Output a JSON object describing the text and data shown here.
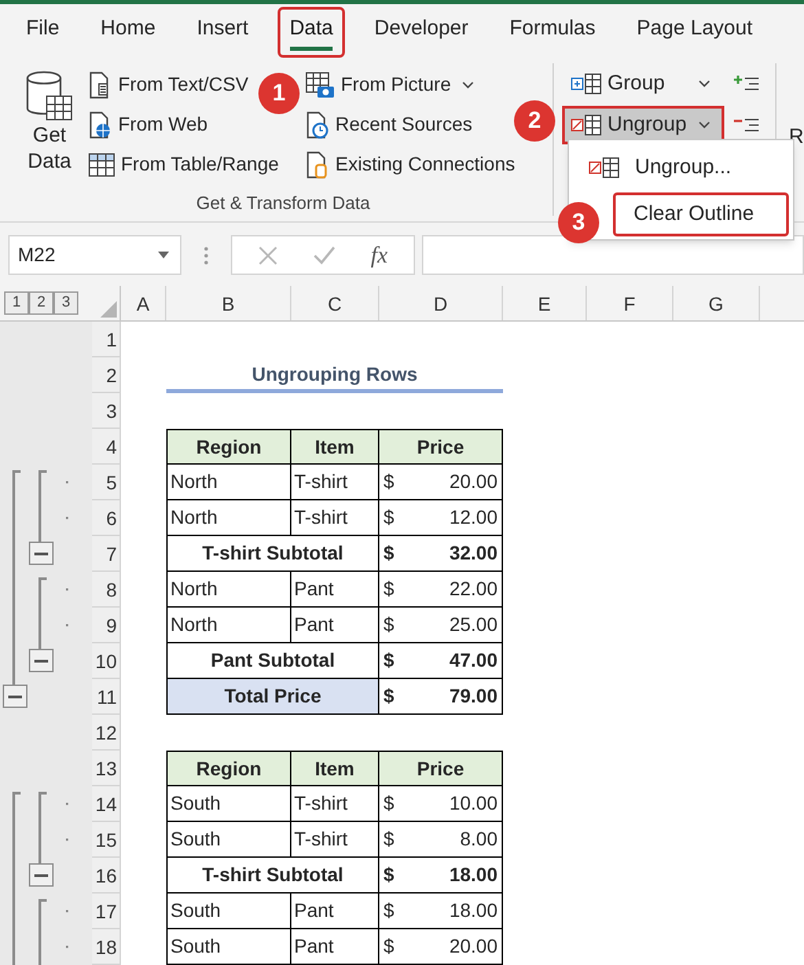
{
  "ribbon_tabs": [
    {
      "label": "File",
      "selected": false,
      "highlighted": false
    },
    {
      "label": "Home",
      "selected": false,
      "highlighted": false
    },
    {
      "label": "Insert",
      "selected": false,
      "highlighted": false
    },
    {
      "label": "Data",
      "selected": true,
      "highlighted": true
    },
    {
      "label": "Developer",
      "selected": false,
      "highlighted": false
    },
    {
      "label": "Formulas",
      "selected": false,
      "highlighted": false
    },
    {
      "label": "Page Layout",
      "selected": false,
      "highlighted": false
    }
  ],
  "get_data": {
    "label": "Get Data"
  },
  "commands": [
    {
      "kind": "text",
      "label": "From Text/CSV",
      "dropdown": false
    },
    {
      "kind": "web",
      "label": "From Web",
      "dropdown": false
    },
    {
      "kind": "table",
      "label": "From Table/Range",
      "dropdown": false
    },
    {
      "kind": "picture",
      "label": "From Picture",
      "dropdown": true
    },
    {
      "kind": "recent",
      "label": "Recent Sources",
      "dropdown": false
    },
    {
      "kind": "connections",
      "label": "Existing Connections",
      "dropdown": false
    }
  ],
  "group_label": "Get & Transform Data",
  "outline_commands": [
    {
      "kind": "group",
      "label": "Group",
      "expanded": false,
      "highlighted": false
    },
    {
      "kind": "ungroup",
      "label": "Ungroup",
      "expanded": true,
      "highlighted": true
    }
  ],
  "next_group_label": "R",
  "dropdown_menu": [
    {
      "kind": "ungroup",
      "label": "Ungroup...",
      "highlighted": false
    },
    {
      "kind": "clear",
      "label": "Clear Outline",
      "highlighted": true
    }
  ],
  "step_badges": [
    "1",
    "2",
    "3"
  ],
  "formula_bar": {
    "name_box": "M22",
    "function_label": "fx"
  },
  "outline_levels": [
    "1",
    "2",
    "3"
  ],
  "columns": [
    "A",
    "B",
    "C",
    "D",
    "E",
    "F",
    "G"
  ],
  "row_numbers": [
    "1",
    "2",
    "3",
    "4",
    "5",
    "6",
    "7",
    "8",
    "9",
    "10",
    "11",
    "12",
    "13",
    "14",
    "15",
    "16",
    "17",
    "18"
  ],
  "title": "Ungrouping Rows",
  "tables": [
    {
      "header": [
        "Region",
        "Item",
        "Price"
      ],
      "rows": [
        {
          "kind": "item",
          "region": "North",
          "item": "T-shirt",
          "currency": "$",
          "amount": "20.00"
        },
        {
          "kind": "item",
          "region": "North",
          "item": "T-shirt",
          "currency": "$",
          "amount": "12.00"
        },
        {
          "kind": "subtotal",
          "label": "T-shirt Subtotal",
          "currency": "$",
          "amount": "32.00",
          "expanded": true
        },
        {
          "kind": "item",
          "region": "North",
          "item": "Pant",
          "currency": "$",
          "amount": "22.00"
        },
        {
          "kind": "item",
          "region": "North",
          "item": "Pant",
          "currency": "$",
          "amount": "25.00"
        },
        {
          "kind": "subtotal",
          "label": "Pant Subtotal",
          "currency": "$",
          "amount": "47.00",
          "expanded": true
        },
        {
          "kind": "total",
          "label": "Total Price",
          "currency": "$",
          "amount": "79.00",
          "expanded": true
        }
      ]
    },
    {
      "header": [
        "Region",
        "Item",
        "Price"
      ],
      "rows": [
        {
          "kind": "item",
          "region": "South",
          "item": "T-shirt",
          "currency": "$",
          "amount": "10.00"
        },
        {
          "kind": "item",
          "region": "South",
          "item": "T-shirt",
          "currency": "$",
          "amount": "8.00"
        },
        {
          "kind": "subtotal",
          "label": "T-shirt Subtotal",
          "currency": "$",
          "amount": "18.00",
          "expanded": true
        },
        {
          "kind": "item",
          "region": "South",
          "item": "Pant",
          "currency": "$",
          "amount": "18.00"
        },
        {
          "kind": "item",
          "region": "South",
          "item": "Pant",
          "currency": "$",
          "amount": "20.00"
        }
      ]
    }
  ]
}
